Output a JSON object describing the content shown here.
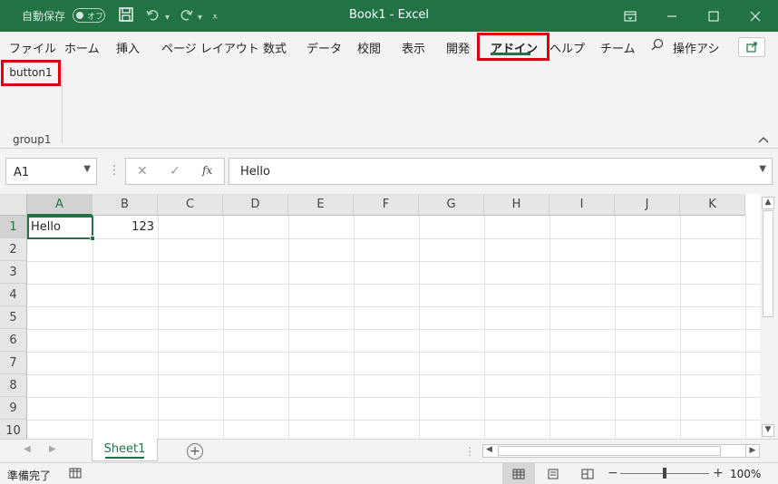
{
  "titlebar": {
    "autosave_label": "自動保存",
    "autosave_state": "オフ",
    "title": "Book1  -  Excel",
    "save_icon": "save-icon",
    "undo_icon": "undo-icon",
    "redo_icon": "redo-icon",
    "customize_icon": "customize-qat-icon",
    "window_buttons": [
      "ribbon-display-options",
      "minimize",
      "maximize",
      "close"
    ]
  },
  "ribbon_tabs": [
    {
      "label": "ファイル"
    },
    {
      "label": "ホーム"
    },
    {
      "label": "挿入"
    },
    {
      "label": "ページ レイアウト"
    },
    {
      "label": "数式"
    },
    {
      "label": "データ"
    },
    {
      "label": "校閲"
    },
    {
      "label": "表示"
    },
    {
      "label": "開発"
    },
    {
      "label": "アドイン",
      "active": true
    },
    {
      "label": "ヘルプ"
    },
    {
      "label": "チーム"
    }
  ],
  "tell_me": {
    "label": "操作アシ"
  },
  "ribbon": {
    "button_label": "button1",
    "group_label": "group1"
  },
  "formula_bar": {
    "name_box": "A1",
    "formula": "Hello"
  },
  "columns": [
    "A",
    "B",
    "C",
    "D",
    "E",
    "F",
    "G",
    "H",
    "I",
    "J",
    "K"
  ],
  "rows": [
    "1",
    "2",
    "3",
    "4",
    "5",
    "6",
    "7",
    "8",
    "9",
    "10"
  ],
  "cells": {
    "A1": "Hello",
    "B1": "123"
  },
  "sheets": [
    {
      "name": "Sheet1",
      "active": true
    }
  ],
  "statusbar": {
    "status": "準備完了",
    "zoom": "100%",
    "zoom_fraction": 0.5
  },
  "colors": {
    "accent": "#217346",
    "highlight": "#e0000d"
  }
}
